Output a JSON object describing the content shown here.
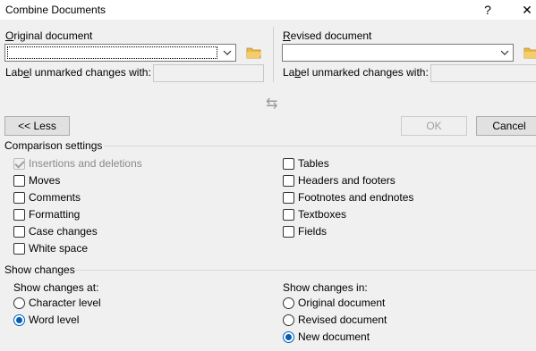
{
  "window": {
    "title": "Combine Documents",
    "help_label": "?",
    "close_label": "✕"
  },
  "original": {
    "label": "Original document",
    "label_unmarked": "Label unmarked changes with:",
    "value": "",
    "unmarked_value": ""
  },
  "revised": {
    "label": "Revised document",
    "label_unmarked": "Label unmarked changes with:",
    "value": "",
    "unmarked_value": ""
  },
  "swap_icon": "⇆",
  "buttons": {
    "less": "<< Less",
    "ok": "OK",
    "cancel": "Cancel"
  },
  "comparison": {
    "header": "Comparison settings",
    "left": [
      {
        "label": "Insertions and deletions",
        "checked": true,
        "disabled": true
      },
      {
        "label": "Moves",
        "checked": false
      },
      {
        "label": "Comments",
        "checked": false
      },
      {
        "label": "Formatting",
        "checked": false
      },
      {
        "label": "Case changes",
        "checked": false
      },
      {
        "label": "White space",
        "checked": false
      }
    ],
    "right": [
      {
        "label": "Tables",
        "checked": false
      },
      {
        "label": "Headers and footers",
        "checked": false
      },
      {
        "label": "Footnotes and endnotes",
        "checked": false
      },
      {
        "label": "Textboxes",
        "checked": false
      },
      {
        "label": "Fields",
        "checked": false
      }
    ]
  },
  "show_changes": {
    "header": "Show changes",
    "at_label": "Show changes at:",
    "at_options": [
      {
        "label": "Character level",
        "selected": false
      },
      {
        "label": "Word level",
        "selected": true
      }
    ],
    "in_label": "Show changes in:",
    "in_options": [
      {
        "label": "Original document",
        "selected": false
      },
      {
        "label": "Revised document",
        "selected": false
      },
      {
        "label": "New document",
        "selected": true
      }
    ]
  },
  "colors": {
    "accent": "#005fb8",
    "background": "#f0f0f0"
  }
}
